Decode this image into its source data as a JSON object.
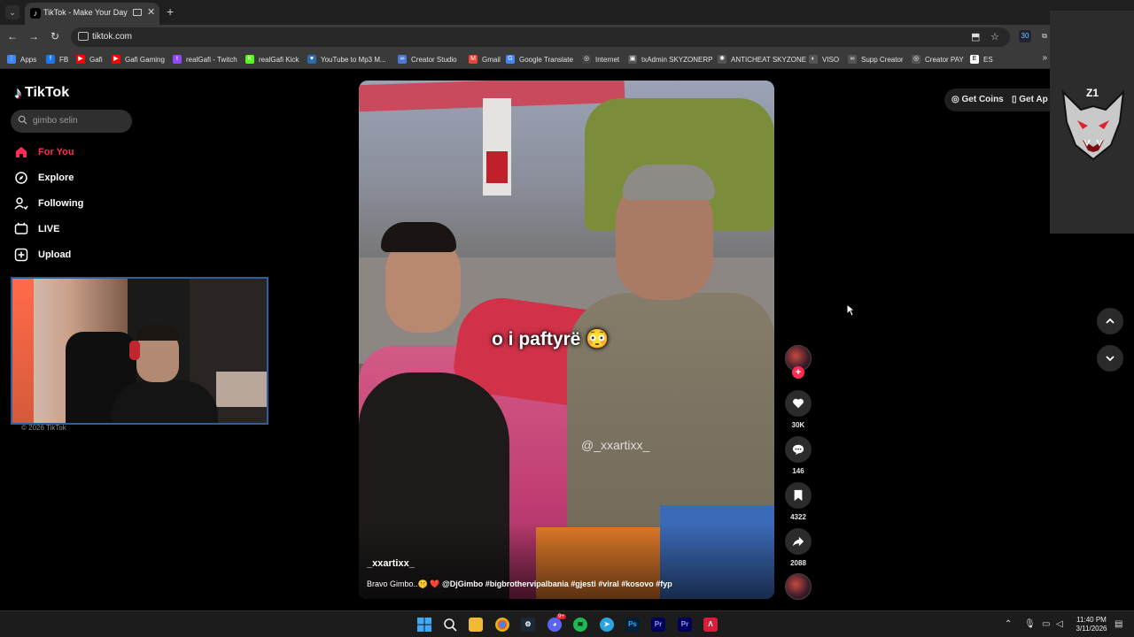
{
  "browser": {
    "tab_title": "TikTok - Make Your Day",
    "url": "tiktok.com",
    "bookmarks": [
      {
        "label": "Apps",
        "color": "#4285f4",
        "glyph": "⋮"
      },
      {
        "label": "FB",
        "color": "#1877f2",
        "glyph": "f"
      },
      {
        "label": "Gafi",
        "color": "#ff0000",
        "glyph": "▶"
      },
      {
        "label": "Gafi Gaming",
        "color": "#ff0000",
        "glyph": "▶"
      },
      {
        "label": "realGafi - Twitch",
        "color": "#9146ff",
        "glyph": "t"
      },
      {
        "label": "realGafi Kick",
        "color": "#53fc18",
        "glyph": "K"
      },
      {
        "label": "YouTube to Mp3 M...",
        "color": "#2b6cb0",
        "glyph": "♥"
      },
      {
        "label": "Creator Studio",
        "color": "#4a78d6",
        "glyph": "∞"
      },
      {
        "label": "Gmail",
        "color": "#ea4335",
        "glyph": "M"
      },
      {
        "label": "Google Translate",
        "color": "#4285f4",
        "glyph": "G"
      },
      {
        "label": "Internet",
        "color": "#444444",
        "glyph": "◎"
      },
      {
        "label": "txAdmin SKYZONERP",
        "color": "#555555",
        "glyph": "▣"
      },
      {
        "label": "ANTICHEAT SKYZONE",
        "color": "#555555",
        "glyph": "✺"
      },
      {
        "label": "VISO",
        "color": "#555555",
        "glyph": "◐"
      },
      {
        "label": "Supp Creator",
        "color": "#555555",
        "glyph": "∞"
      },
      {
        "label": "Creator PAY",
        "color": "#555555",
        "glyph": "◎"
      },
      {
        "label": "ES",
        "color": "#ffffff",
        "glyph": "E"
      }
    ],
    "extension_badge": "30"
  },
  "tiktok": {
    "logo_text": "TikTok",
    "search_value": "gimbo selin",
    "nav": [
      {
        "label": "For You",
        "icon": "home-icon",
        "active": true
      },
      {
        "label": "Explore",
        "icon": "compass-icon",
        "active": false
      },
      {
        "label": "Following",
        "icon": "following-icon",
        "active": false
      },
      {
        "label": "LIVE",
        "icon": "live-icon",
        "active": false
      },
      {
        "label": "Upload",
        "icon": "upload-icon",
        "active": false
      }
    ],
    "copyright": "© 2026 TikTok",
    "get_coins": "Get Coins",
    "get_app": "Get Ap",
    "video": {
      "overlay_caption": "o i paftyrë 😳",
      "watermark": "@_xxartixx_",
      "author": "_xxartixx_",
      "description_start": "Bravo Gimbo..🤫 ❤️ ",
      "description_tags": "@DjGimbo #bigbrothervipalbania #gjesti #viral #kosovo #fyp"
    },
    "actions": {
      "likes": "30K",
      "comments": "146",
      "saves": "4322",
      "shares": "2088"
    },
    "overlay_badge": "Z1"
  },
  "taskbar": {
    "time": "11:40 PM",
    "date": "3/11/2026",
    "discord_badge": "9+"
  },
  "colors": {
    "accent": "#fe2c55",
    "background": "#000000"
  }
}
